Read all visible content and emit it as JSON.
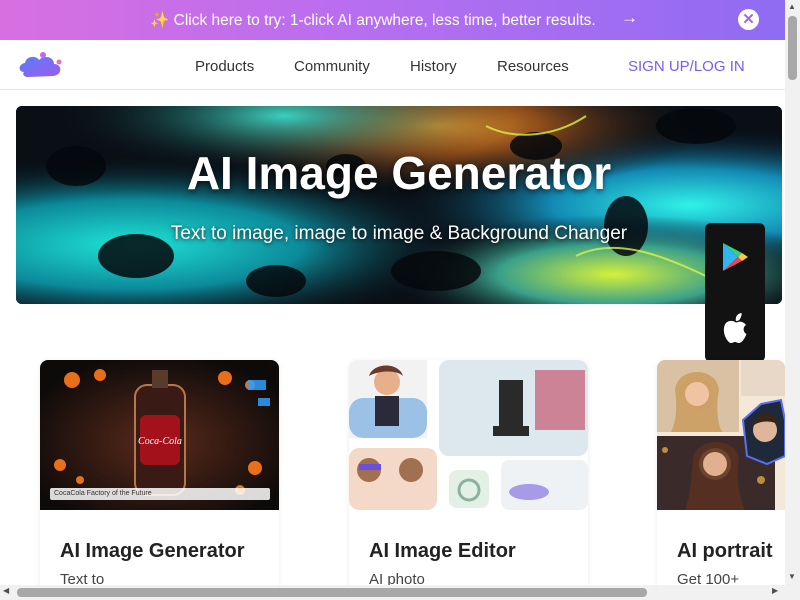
{
  "promo": {
    "sparkle": "✨",
    "text": "Click here to try: 1-click AI anywhere, less time, better results.",
    "arrow": "→",
    "close": "✕"
  },
  "nav": {
    "items": [
      "Products",
      "Community",
      "History",
      "Resources"
    ],
    "signup": "SIGN UP/LOG IN"
  },
  "hero": {
    "title": "AI Image Generator",
    "subtitle": "Text to image, image to image & Background Changer"
  },
  "app_badges": {
    "icons": [
      "google-play-icon",
      "apple-icon"
    ]
  },
  "cards": [
    {
      "title": "AI Image Generator",
      "desc": "Text to",
      "thumb_caption": "CocaCola Factory of the Future"
    },
    {
      "title": "AI Image Editor",
      "desc": "AI photo"
    },
    {
      "title": "AI portrait",
      "desc": "Get 100+"
    }
  ],
  "colors": {
    "promo_start": "#d86fe0",
    "promo_end": "#8f6cf2",
    "signup": "#7a5cf0",
    "badge_bg": "#121212"
  }
}
